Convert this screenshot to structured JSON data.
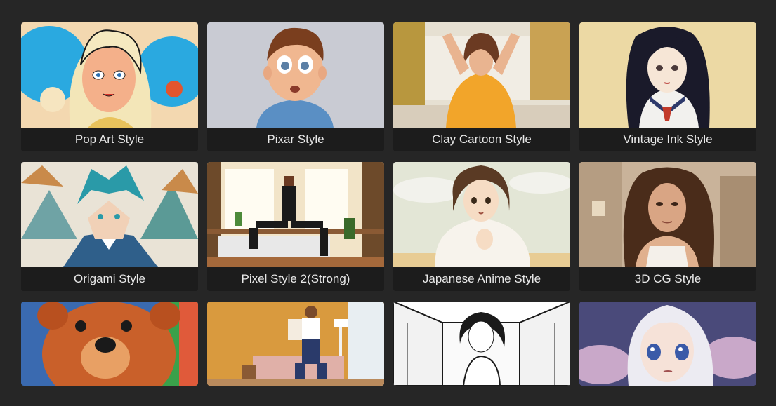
{
  "styles": [
    {
      "label": "Pop Art Style"
    },
    {
      "label": "Pixar Style"
    },
    {
      "label": "Clay Cartoon Style"
    },
    {
      "label": "Vintage Ink Style"
    },
    {
      "label": "Origami Style"
    },
    {
      "label": "Pixel Style 2(Strong)"
    },
    {
      "label": "Japanese Anime Style"
    },
    {
      "label": "3D CG Style"
    }
  ],
  "colors": {
    "background": "#262626",
    "card_label_bg": "#1c1c1c",
    "label_text": "#e8e8e8"
  }
}
